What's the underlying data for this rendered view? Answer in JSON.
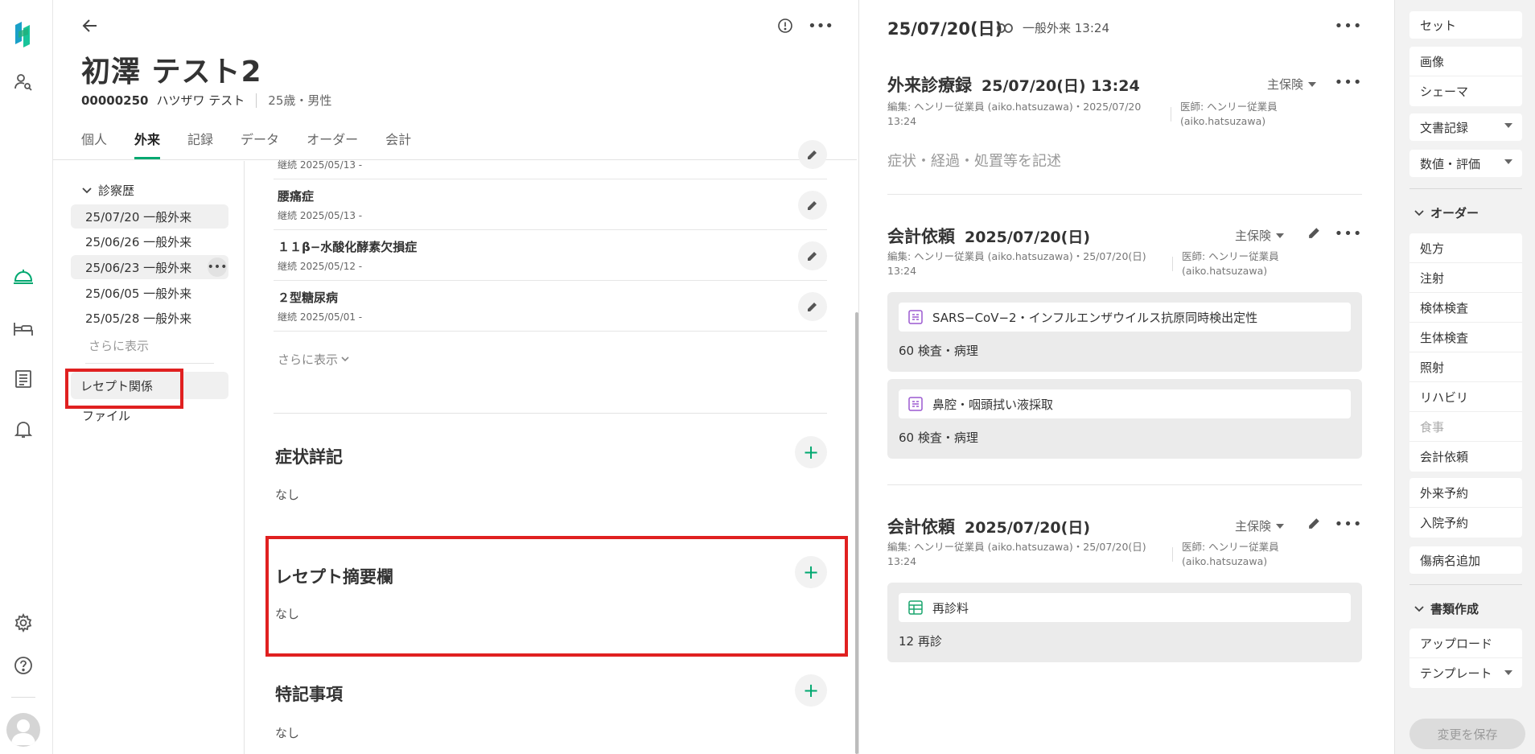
{
  "patient": {
    "name": "初澤 テスト2",
    "id": "00000250",
    "kana": "ハツザワ テスト",
    "age_sex": "25歳・男性"
  },
  "tabs": [
    "個人",
    "外来",
    "記録",
    "データ",
    "オーダー",
    "会計"
  ],
  "active_tab": "外来",
  "history": {
    "title": "診察歴",
    "items": [
      "25/07/20 一般外来",
      "25/06/26 一般外来",
      "25/06/23 一般外来",
      "25/06/05 一般外来",
      "25/05/28 一般外来"
    ],
    "show_more": "さらに表示",
    "rezept": "レセプト関係",
    "file": "ファイル"
  },
  "diseases": {
    "rows": [
      {
        "name": "",
        "date": "継続 2025/05/13 -"
      },
      {
        "name": "腰痛症",
        "date": "継続 2025/05/13 -"
      },
      {
        "name": "１１β−水酸化酵素欠損症",
        "date": "継続 2025/05/12 -"
      },
      {
        "name": "２型糖尿病",
        "date": "継続 2025/05/01 -"
      }
    ],
    "show_more": "さらに表示"
  },
  "sections": [
    {
      "title": "症状詳記",
      "value": "なし"
    },
    {
      "title": "レセプト摘要欄",
      "value": "なし"
    },
    {
      "title": "特記事項",
      "value": "なし"
    }
  ],
  "record": {
    "top_date": "25/07/20(日)",
    "top_text": "一般外来 13:24",
    "card1": {
      "title": "外来診療録",
      "date": "25/07/20(日) 13:24",
      "insurance": "主保険",
      "meta": "編集: ヘンリー従業員 (aiko.hatsuzawa)・2025/07/20 13:24",
      "doctor": "医師: ヘンリー従業員 (aiko.hatsuzawa)",
      "placeholder": "症状・経過・処置等を記述"
    },
    "card2": {
      "title": "会計依頼",
      "date": "2025/07/20(日)",
      "insurance": "主保険",
      "meta": "編集: ヘンリー従業員 (aiko.hatsuzawa)・25/07/20(日) 13:24",
      "doctor": "医師: ヘンリー従業員 (aiko.hatsuzawa)",
      "orders": [
        {
          "name": "SARS−CoV−2・インフルエンザウイルス抗原同時検出定性",
          "foot": "60 検査・病理"
        },
        {
          "name": "鼻腔・咽頭拭い液採取",
          "foot": "60 検査・病理"
        }
      ]
    },
    "card3": {
      "title": "会計依頼",
      "date": "2025/07/20(日)",
      "insurance": "主保険",
      "meta": "編集: ヘンリー従業員 (aiko.hatsuzawa)・25/07/20(日) 13:24",
      "doctor": "医師: ヘンリー従業員 (aiko.hatsuzawa)",
      "orders": [
        {
          "name": "再診料",
          "foot": "12 再診"
        }
      ]
    }
  },
  "sidebar": {
    "set": "セット",
    "image": "画像",
    "schema": "シェーマ",
    "doc_record": "文書記録",
    "numeric": "数値・評価",
    "order_head": "オーダー",
    "orders": [
      "処方",
      "注射",
      "検体検査",
      "生体検査",
      "照射",
      "リハビリ",
      "食事",
      "会計依頼"
    ],
    "outpatient_reserve": "外来予約",
    "admission_reserve": "入院予約",
    "add_disease": "傷病名追加",
    "docs_head": "書類作成",
    "upload": "アップロード",
    "template": "テンプレート",
    "save": "変更を保存"
  },
  "colors": {
    "accent": "#00a870",
    "highlight": "#e02020",
    "order_icon_purple": "#9b59d0",
    "order_icon_green": "#1aa56f"
  }
}
